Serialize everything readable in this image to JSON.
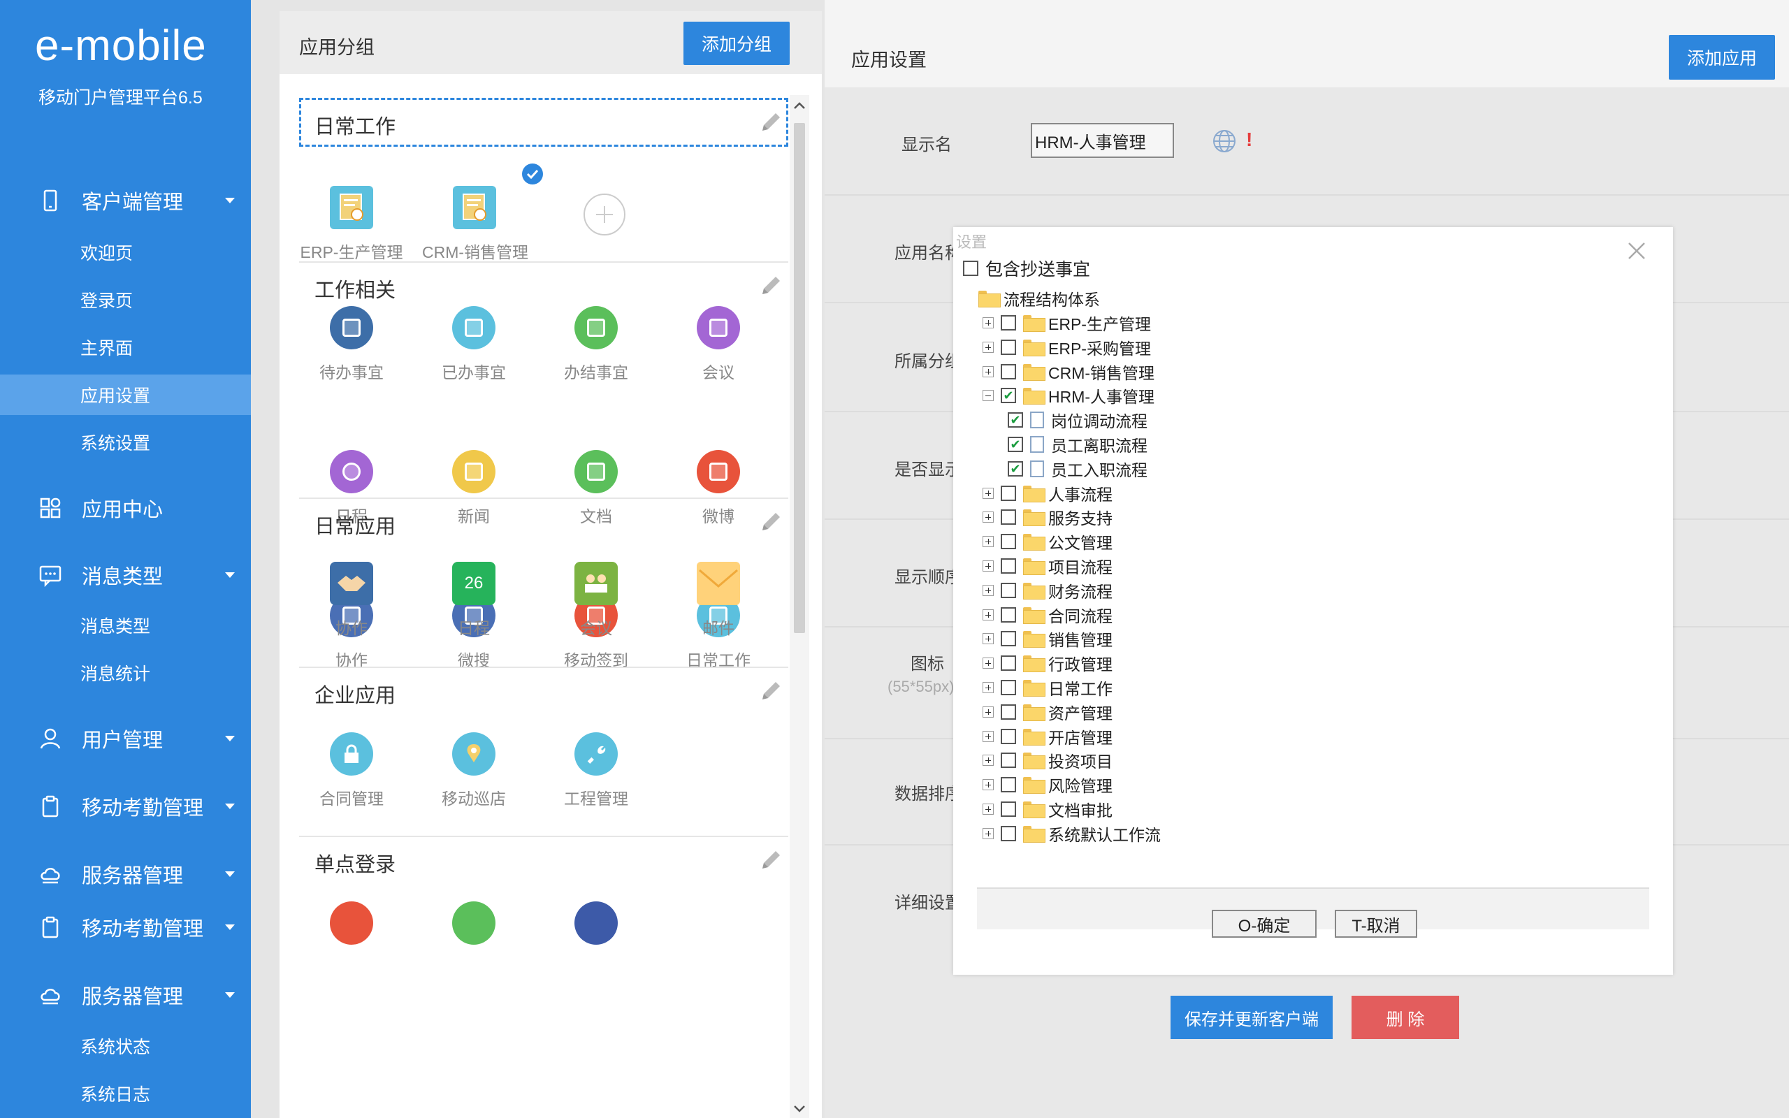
{
  "sidebar": {
    "logo": "e-mobile",
    "subtitle": "移动门户管理平台6.5",
    "nav": [
      {
        "label": "客户端管理",
        "icon": "mobile-icon"
      },
      {
        "label": "应用中心",
        "icon": "grid-icon"
      },
      {
        "label": "消息类型",
        "icon": "message-icon"
      },
      {
        "label": "用户管理",
        "icon": "user-icon"
      },
      {
        "label": "移动考勤管理",
        "icon": "clipboard-icon"
      },
      {
        "label": "服务器管理",
        "icon": "cloud-icon"
      },
      {
        "label": "移动考勤管理",
        "icon": "clipboard-icon"
      },
      {
        "label": "服务器管理",
        "icon": "cloud-icon"
      }
    ],
    "sub": {
      "client": [
        "欢迎页",
        "登录页",
        "主界面",
        "应用设置",
        "系统设置"
      ],
      "message": [
        "消息类型",
        "消息统计"
      ],
      "server": [
        "系统状态",
        "系统日志"
      ]
    },
    "active_sub": "应用设置",
    "accent_color": "#2d86dd"
  },
  "middle": {
    "title": "应用分组",
    "add_group_button": "添加分组",
    "groups": [
      {
        "title": "日常工作",
        "apps": [
          "ERP-生产管理",
          "CRM-销售管理"
        ]
      },
      {
        "title": "工作相关",
        "apps": [
          "待办事宜",
          "已办事宜",
          "办结事宜",
          "会议",
          "日程",
          "新闻",
          "文档",
          "微博",
          "协作",
          "微搜",
          "移动签到",
          "日常工作"
        ]
      },
      {
        "title": "日常应用",
        "apps": [
          "协作",
          "日程",
          "会议",
          "邮件"
        ],
        "calendar_day": "26"
      },
      {
        "title": "企业应用",
        "apps": [
          "合同管理",
          "移动巡店",
          "工程管理"
        ]
      },
      {
        "title": "单点登录",
        "apps": [
          "",
          "",
          ""
        ]
      }
    ]
  },
  "right": {
    "title": "应用设置",
    "add_app_button": "添加应用",
    "labels": {
      "display_name": "显示名",
      "app_name": "应用名称",
      "group": "所属分组",
      "show": "是否显示",
      "order": "显示顺序",
      "icon": "图标",
      "icon_size": "(55*55px)",
      "data_sort": "数据排序",
      "detail": "详细设置"
    },
    "display_name_value": "HRM-人事管理",
    "required_mark": "!",
    "save_button": "保存并更新客户端",
    "delete_button": "删 除"
  },
  "dialog": {
    "title": "设置",
    "include_cc": "包含抄送事宜",
    "root": "流程结构体系",
    "top_items": [
      {
        "label": "ERP-生产管理",
        "checked": false
      },
      {
        "label": "ERP-采购管理",
        "checked": false
      },
      {
        "label": "CRM-销售管理",
        "checked": false
      },
      {
        "label": "HRM-人事管理",
        "checked": true,
        "expanded": true
      }
    ],
    "hrm_children": [
      "岗位调动流程",
      "员工离职流程",
      "员工入职流程"
    ],
    "more_items": [
      "人事流程",
      "服务支持",
      "公文管理",
      "项目流程",
      "财务流程",
      "合同流程",
      "销售管理",
      "行政管理",
      "日常工作",
      "资产管理",
      "开店管理",
      "投资项目",
      "风险管理",
      "文档审批",
      "系统默认工作流"
    ],
    "ok_button": "O-确定",
    "cancel_button": "T-取消"
  }
}
